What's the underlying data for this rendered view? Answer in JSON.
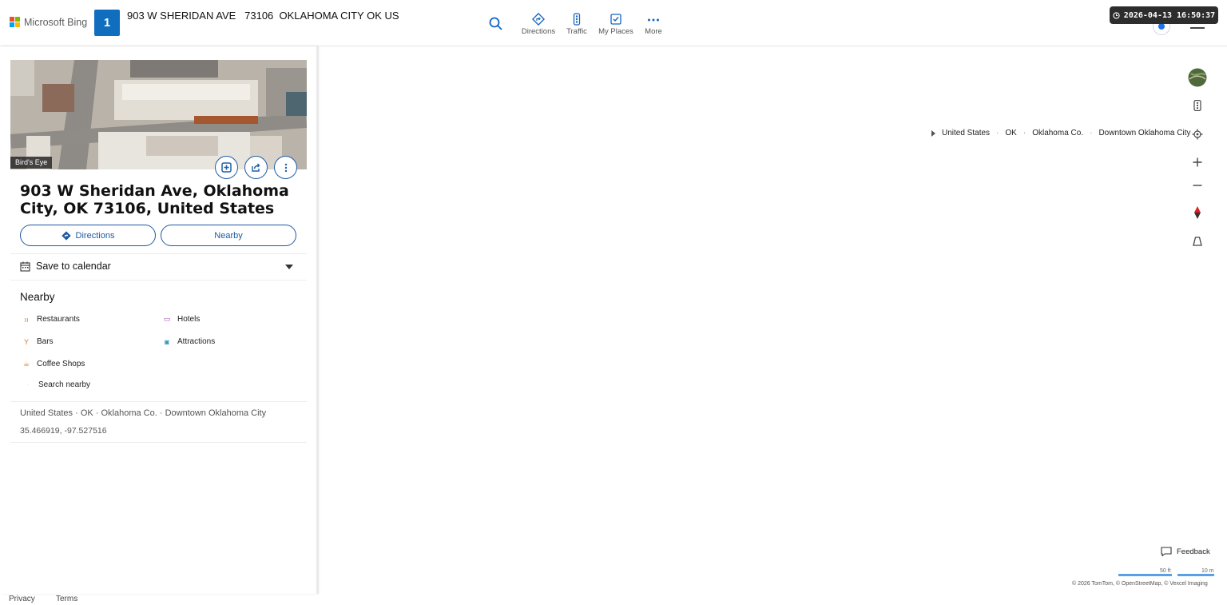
{
  "header": {
    "logo_text": "Microsoft Bing",
    "route_number": "1",
    "query": "903 W SHERIDAN AVE   73106  OKLAHOMA CITY OK US",
    "nav": [
      {
        "label": "Directions",
        "icon": "directions-icon"
      },
      {
        "label": "Traffic",
        "icon": "traffic-icon"
      },
      {
        "label": "My Places",
        "icon": "my-places-icon"
      },
      {
        "label": "More",
        "icon": "more-icon"
      }
    ],
    "timestamp": "2026-04-13 16:50:37"
  },
  "panel": {
    "image_label": "Bird's Eye",
    "address_title": "903 W Sheridan Ave, Oklahoma City, OK 73106, United States",
    "directions_label": "Directions",
    "nearby_button_label": "Nearby",
    "save_calendar_label": "Save to calendar",
    "nearby_heading": "Nearby",
    "nearby_items": [
      {
        "label": "Restaurants",
        "icon": "restaurant-icon",
        "color": "#e07b22"
      },
      {
        "label": "Hotels",
        "icon": "hotel-icon",
        "color": "#b04fb8"
      },
      {
        "label": "Bars",
        "icon": "bar-icon",
        "color": "#e07b22"
      },
      {
        "label": "Attractions",
        "icon": "attraction-icon",
        "color": "#2a8fbf"
      },
      {
        "label": "Coffee Shops",
        "icon": "coffee-icon",
        "color": "#e07b22"
      },
      {
        "label": "Search nearby",
        "icon": "search-icon",
        "color": "#999999"
      }
    ],
    "breadcrumb": "United States · OK · Oklahoma Co. · Downtown Oklahoma City",
    "coordinates": "35.466919, -97.527516"
  },
  "map": {
    "breadcrumb": [
      "United States",
      "OK",
      "Oklahoma Co.",
      "Downtown Oklahoma City"
    ],
    "feedback_label": "Feedback",
    "scale_ft": "50 ft",
    "scale_m": "10 m",
    "copyright": "© 2026 TomTom,  © OpenStreetMap, © Vexcel Imaging"
  },
  "footer": {
    "privacy": "Privacy",
    "terms": "Terms"
  },
  "colors": {
    "accent": "#106ebe",
    "button_border": "#1e5aa0"
  }
}
